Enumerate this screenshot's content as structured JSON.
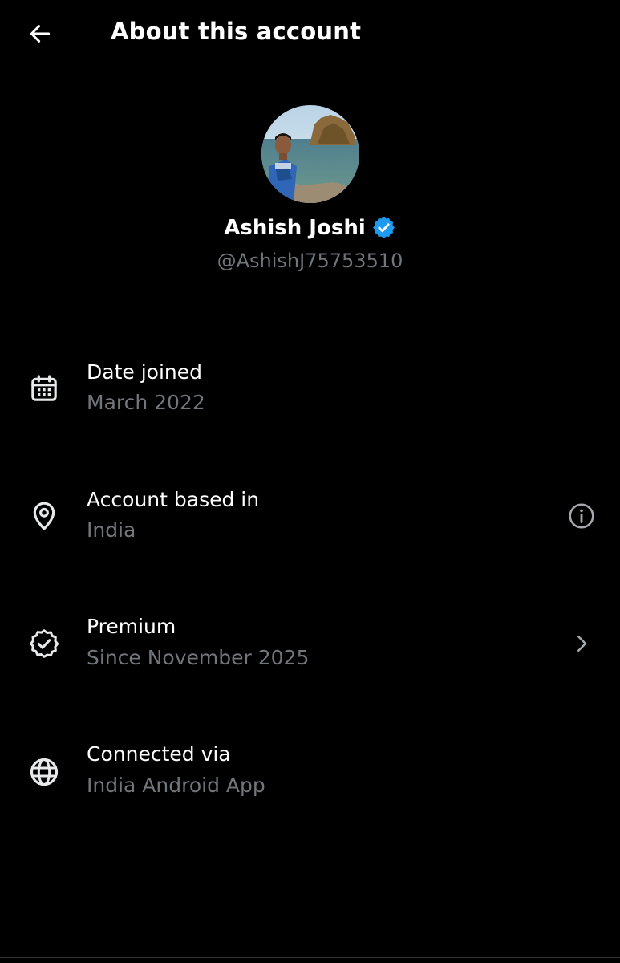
{
  "header": {
    "title": "About this account",
    "back_icon": "arrow-left-icon"
  },
  "profile": {
    "display_name": "Ashish Joshi",
    "handle": "@AshishJ75753510",
    "verified": true,
    "verified_color": "#1d9bf0"
  },
  "rows": [
    {
      "icon": "calendar-icon",
      "title": "Date joined",
      "value": "March 2022"
    },
    {
      "icon": "location-pin-icon",
      "title": "Account based in",
      "value": "India",
      "trailing_icon": "info-icon"
    },
    {
      "icon": "verified-badge-icon",
      "title": "Premium",
      "value": "Since November 2025",
      "trailing_icon": "chevron-right-icon"
    },
    {
      "icon": "globe-icon",
      "title": "Connected via",
      "value": "India Android App"
    }
  ],
  "colors": {
    "background": "#000000",
    "primary_text": "#ffffff",
    "secondary_text": "#71767b",
    "icon": "#e7e9ea"
  }
}
